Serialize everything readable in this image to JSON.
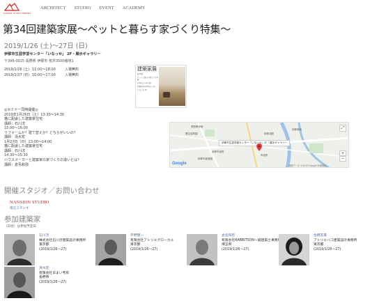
{
  "logo": {
    "text": "NASHIN STUDIO SERIES"
  },
  "nav": [
    "ARCHITECT",
    "STUDIO",
    "EVENT",
    "ACADEMY"
  ],
  "event": {
    "title": "第34回建築家展〜ペットと暮らす家づくり特集〜",
    "date": "2019/1/26 (土)〜27日 (日)",
    "venue": "伊那市生涯学習センター「いなっせ」 2F・展示ギャラリー",
    "address": "〒396-0025 長野県 伊那市 荒井3500番地1",
    "hours": [
      {
        "day": "2019/1/26 (土)",
        "time": "11:00〜18:00",
        "fee": "入場無料"
      },
      {
        "day": "2019/1/27 (日)",
        "time": "10:00〜17:00",
        "fee": "入場無料"
      }
    ]
  },
  "flyer": {
    "headline": "建築家展",
    "small_lines": [
      "第34回",
      "ペットと暮らす家づくり特集",
      "1/26(土)〜27(日)",
      "伊那市生涯学習センター",
      "いなっせ 2F"
    ]
  },
  "seminar": [
    "◎セミナー同時開催◎",
    "2019年1月26日（土）13:30〜14:30",
    "猫に配慮した建築家住宅",
    "講師：石川淳",
    "15:00〜16:00",
    "リフォームか？建て替えか？どちらがいいの？",
    "講師：清水宏",
    "1月27日（日）13:00〜14:00",
    "猫に配慮した建築家住宅",
    "講師：石川淳",
    "14:30〜15:30",
    "ハウスメーカーと建築家の家づくりの違いとは？",
    "講師：倉島和弥"
  ],
  "map": {
    "label": "伊那市生涯学習センター「いなっせ」2F・展示ギャラリー",
    "places": [
      "長野県伊那",
      "養生保育園",
      "伊那市役所",
      "伊那市創造館",
      "伊那北駅",
      "市役所",
      "伊那食品"
    ],
    "brand": "Google",
    "footer": "地図データ ©2019 Google  利用規約"
  },
  "studio_section": {
    "heading": "開催スタジオ／お問い合わせ",
    "studio_name": "NANSHIN STUDIO",
    "studio_sub": "南信スタジオ"
  },
  "architects_section": {
    "heading": "参加建築家",
    "note": "（日付）は参加予定日",
    "architects": [
      {
        "name": "石川淳",
        "office": "株式会社石川淳建築設計事務所",
        "region": "東京都",
        "dates": "(2019/1/26〜27)"
      },
      {
        "name": "宇野健一",
        "office": "有限会社アトリエグローカル",
        "region": "東京都",
        "dates": "(2019/1/26〜27)"
      },
      {
        "name": "倉島和弥",
        "office": "有限会社RABBITSON一級建築士事務所",
        "region": "埼玉県",
        "dates": "(2019/1/26〜27)"
      },
      {
        "name": "佐野友美",
        "office": "アトリエハコ建築設計事務所",
        "region": "東京都",
        "dates": "(2019/1/26〜27)"
      },
      {
        "name": "清水宏",
        "office": "有限会社日まい考房",
        "region": "長野県",
        "dates": "(2019/1/26〜27)"
      }
    ]
  }
}
